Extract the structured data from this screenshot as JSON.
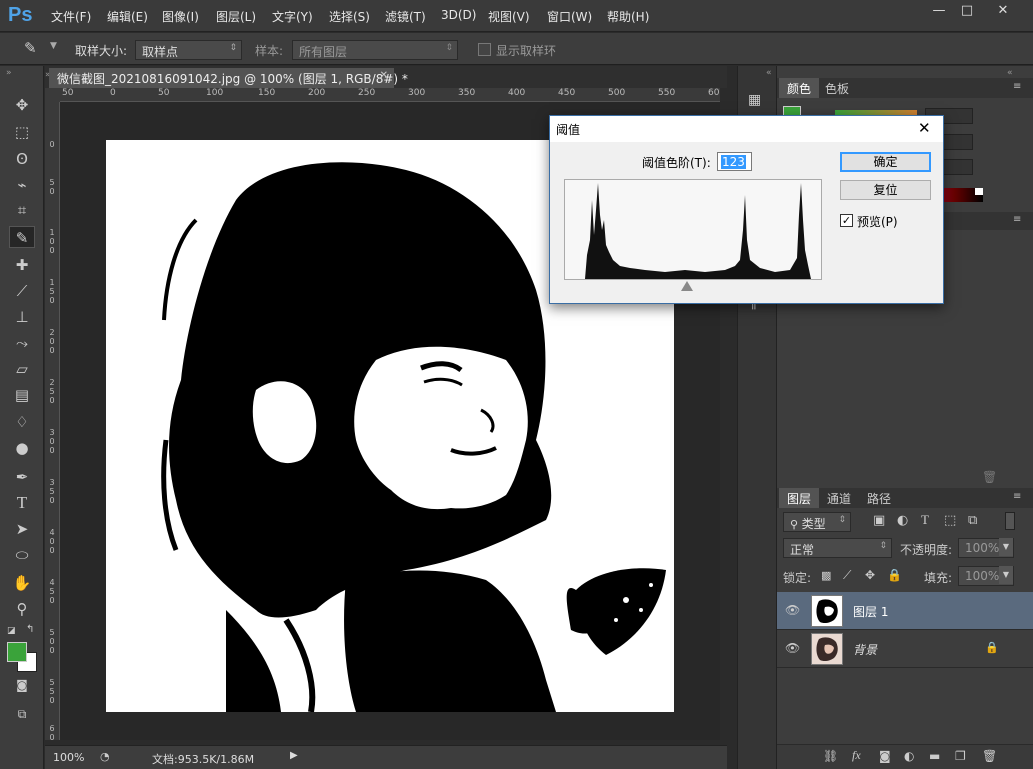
{
  "app": {
    "logo": "Ps"
  },
  "menu": [
    "文件(F)",
    "编辑(E)",
    "图像(I)",
    "图层(L)",
    "文字(Y)",
    "选择(S)",
    "滤镜(T)",
    "3D(D)",
    "视图(V)",
    "窗口(W)",
    "帮助(H)"
  ],
  "window": {
    "minimize": "—",
    "restore": "□",
    "close": "✕"
  },
  "options": {
    "sample_size_label": "取样大小:",
    "sample_size_value": "取样点",
    "sample_label": "样本:",
    "sample_value": "所有图层",
    "show_ring_label": "显示取样环"
  },
  "document": {
    "tab_title": "微信截图_20210816091042.jpg @ 100% (图层 1, RGB/8#) *",
    "tab_close": "✕"
  },
  "ruler": {
    "h_ticks": [
      "50",
      "0",
      "50",
      "100",
      "150",
      "200",
      "250",
      "300",
      "350",
      "400",
      "450",
      "500",
      "550",
      "60"
    ],
    "v_ticks": [
      "0",
      "5 0",
      "1 0 0",
      "1 5 0",
      "2 0 0",
      "2 5 0",
      "3 0 0",
      "3 5 0",
      "4 0 0",
      "4 5 0",
      "5 0 0",
      "5 5 0",
      "6 0"
    ]
  },
  "status": {
    "zoom": "100%",
    "doc_info": "文档:953.5K/1.86M"
  },
  "threshold_dialog": {
    "title": "阈值",
    "level_label": "阈值色阶(T):",
    "level_value": "123",
    "ok": "确定",
    "reset": "复位",
    "preview_label": "预览(P)",
    "preview_checked": true,
    "close": "✕"
  },
  "right_panel": {
    "color_tabs": [
      "颜色",
      "色板"
    ],
    "layers_tabs": [
      "图层",
      "通道",
      "路径"
    ],
    "filter_kind": "类型",
    "blend_mode": "正常",
    "opacity_label": "不透明度:",
    "opacity_value": "100%",
    "lock_label": "锁定:",
    "fill_label": "填充:",
    "fill_value": "100%",
    "layers": [
      {
        "name": "图层 1",
        "selected": true,
        "locked": false
      },
      {
        "name": "背景",
        "selected": false,
        "locked": true
      }
    ]
  },
  "colors": {
    "foreground": "#3aa33a",
    "background": "#ffffff",
    "accent": "#4fa3e8",
    "selected_layer": "#5a6a7e"
  }
}
